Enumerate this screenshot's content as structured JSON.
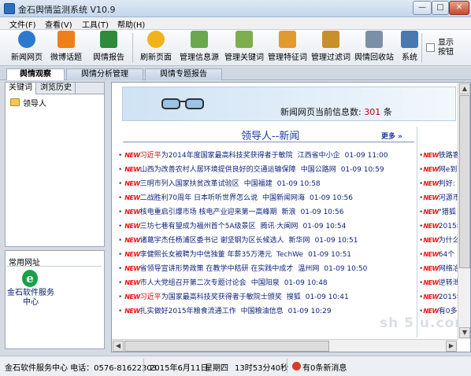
{
  "window": {
    "title": "金石舆情监测系统 V10.9",
    "minimize": "—",
    "maximize": "□",
    "close": "✕"
  },
  "menu": [
    "文件(F)",
    "查看(V)",
    "工具(T)",
    "帮助(H)"
  ],
  "toolbar": {
    "buttons": [
      {
        "label": "新闻网页",
        "icon": "news-web-icon",
        "color": "#2b7ad0"
      },
      {
        "label": "微博话题",
        "icon": "weibo-rss-icon",
        "color": "#f07f1a"
      },
      {
        "label": "舆情报告",
        "icon": "excel-report-icon",
        "color": "#2f8a3a"
      },
      {
        "label": "刷新页面",
        "icon": "refresh-star-icon",
        "color": "#f0b31c"
      },
      {
        "label": "管理信息源",
        "icon": "source-list-icon",
        "color": "#6aa84f"
      },
      {
        "label": "管理关键词",
        "icon": "keyword-table-icon",
        "color": "#7fae4c"
      },
      {
        "label": "管理特征词",
        "icon": "feature-word-icon",
        "color": "#e29a2e"
      },
      {
        "label": "管理过滤词",
        "icon": "filter-folder-icon",
        "color": "#c98f2a"
      },
      {
        "label": "舆情回收站",
        "icon": "recycle-bin-icon",
        "color": "#7c8fa8"
      },
      {
        "label": "系统",
        "icon": "system-icon",
        "color": "#4a78b0"
      }
    ],
    "checkbox_label": "显示按钮"
  },
  "main_tabs": [
    "舆情观察",
    "舆情分析管理",
    "舆情专题报告"
  ],
  "left": {
    "subtabs": [
      "关键词",
      "浏览历史"
    ],
    "tree_item": "领导人",
    "quick_title": "常用网址",
    "quick_item": "金石软件服务中心"
  },
  "content": {
    "banner_text": "新闻网页当前信息数:",
    "banner_count": "301",
    "banner_unit": "条",
    "section_title": "领导人--新闻",
    "more": "更多 »",
    "new_tag": "NEW",
    "bullet": "•",
    "news": [
      {
        "hl": "习近平",
        "title": "为2014年度国家最高科技奖获得者于敏院",
        "source": "江西省中小企",
        "date": "01-09 11:00"
      },
      {
        "hl": "",
        "title": "山西为改善农村人居环境提供良好的交通运输保障",
        "source": "中国公路网",
        "date": "01-09 10:59"
      },
      {
        "hl": "",
        "title": "三明市列入国家扶贫改革试验区",
        "source": "中国福建",
        "date": "01-09 10:58"
      },
      {
        "hl": "",
        "title": "二战胜利70周年 日本听听世界怎么说",
        "source": "中国新闻网海",
        "date": "01-09 10:56"
      },
      {
        "hl": "",
        "title": "核电重启引爆市场 核电产业迎来第一高峰期",
        "source": "新浪",
        "date": "01-09 10:56"
      },
      {
        "hl": "",
        "title": "三坊七巷有望成为福州首个5A级景区",
        "source": "腾讯·大闽网",
        "date": "01-09 10:54"
      },
      {
        "hl": "",
        "title": "诸葛宇杰任杨浦区委书记 谢坚钢为区长候选人",
        "source": "新华网",
        "date": "01-09 10:51"
      },
      {
        "hl": "",
        "title": "李健熙长女被聘为中信独董 年薪35万港元",
        "source": "TechWe",
        "date": "01-09 10:51"
      },
      {
        "hl": "",
        "title": "省领导宣讲形势政策 在教学中秸研 在实践中成才",
        "source": "温州网",
        "date": "01-09 10:50"
      },
      {
        "hl": "",
        "title": "市人大党组召开第二次专题讨论会",
        "source": "中国阳泉",
        "date": "01-09 10:48"
      },
      {
        "hl": "习近平",
        "title": "为国家最高科技奖获得者于敏院士颁奖",
        "source": "搜狐",
        "date": "01-09 10:41"
      },
      {
        "hl": "",
        "title": "扎实做好2015年粮食流通工作",
        "source": "中国粮油信息",
        "date": "01-09 10:29"
      }
    ],
    "right_items": [
      "铁路客",
      "网e到",
      "判好:",
      "河源市",
      "\"猎狐",
      "2015年",
      "为什么",
      "64个",
      "网络冶",
      "逆转泄",
      "2015年",
      "有0多"
    ],
    "watermark": "sh 5 u.com",
    "scroll_up": "▲",
    "scroll_down": "▼",
    "scroll_left": "◀",
    "scroll_right": "▶"
  },
  "status": {
    "company": "金石软件服务中心 电话：0576-81622303",
    "date": "2015年6月11日",
    "weekday": "星期四",
    "time": "13时53分40秒",
    "messages": "有0条新消息"
  }
}
